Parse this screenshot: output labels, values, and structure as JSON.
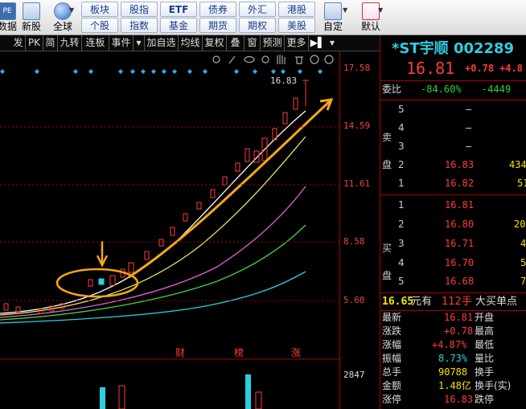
{
  "toolbar": {
    "items": [
      {
        "label": "数据",
        "icon": "data-icon"
      },
      {
        "label": "新股",
        "icon": "ipo-icon"
      },
      {
        "label": "全球",
        "icon": "globe-icon"
      }
    ],
    "market": [
      "板块",
      "股指",
      "ETF",
      "债券",
      "外汇",
      "港股",
      "个股",
      "指数",
      "基金",
      "期货",
      "期权",
      "美股"
    ],
    "right": [
      {
        "label": "自定",
        "icon": "custom-icon"
      },
      {
        "label": "默认",
        "icon": "home-icon"
      }
    ]
  },
  "tabs": [
    "发",
    "PK",
    "简",
    "九转",
    "连板",
    "事件",
    "加自选",
    "均线",
    "复权",
    "叠",
    "窗",
    "预测",
    "更多"
  ],
  "axis": {
    "labels": [
      "17.58",
      "14.59",
      "11.61",
      "8.58",
      "5.60",
      "2847"
    ]
  },
  "chart": {
    "peak_label": "16.83",
    "markers": [
      "财",
      "榜",
      "涨"
    ]
  },
  "quote": {
    "name": "*ST宇顺",
    "code": "002289",
    "price": "16.81",
    "change": "+0.78",
    "pct": "+4.8",
    "wb_label": "委比",
    "wb_pct": "-84.60%",
    "wb_diff": "-4449",
    "sell_label": [
      "卖",
      "盘"
    ],
    "buy_label": [
      "买",
      "盘"
    ],
    "sell": [
      {
        "lvl": "5",
        "p": "–",
        "v": ""
      },
      {
        "lvl": "4",
        "p": "–",
        "v": ""
      },
      {
        "lvl": "3",
        "p": "–",
        "v": ""
      },
      {
        "lvl": "2",
        "p": "16.83",
        "v": "434"
      },
      {
        "lvl": "1",
        "p": "16.82",
        "v": "51"
      }
    ],
    "buy": [
      {
        "lvl": "1",
        "p": "16.81",
        "v": ""
      },
      {
        "lvl": "2",
        "p": "16.80",
        "v": "20"
      },
      {
        "lvl": "3",
        "p": "16.71",
        "v": "4"
      },
      {
        "lvl": "4",
        "p": "16.70",
        "v": "5"
      },
      {
        "lvl": "5",
        "p": "16.68",
        "v": "7"
      }
    ],
    "bigbuy": {
      "price": "16.65",
      "unit": "元有",
      "qty": "112手",
      "tail": "大买单点"
    },
    "detail": [
      {
        "k": "最新",
        "v": "16.81",
        "k2": "开盘",
        "c": "red"
      },
      {
        "k": "涨跌",
        "v": "+0.78",
        "k2": "最高",
        "c": "red"
      },
      {
        "k": "涨幅",
        "v": "+4.87%",
        "k2": "最低",
        "c": "red"
      },
      {
        "k": "振幅",
        "v": "8.73%",
        "k2": "量比",
        "c": "cyan"
      },
      {
        "k": "总手",
        "v": "90788",
        "k2": "换手",
        "c": "yel"
      },
      {
        "k": "金额",
        "v": "1.48亿",
        "k2": "换手(实)",
        "c": "yel"
      },
      {
        "k": "涨停",
        "v": "16.83",
        "k2": "跌停",
        "c": "red"
      }
    ]
  }
}
